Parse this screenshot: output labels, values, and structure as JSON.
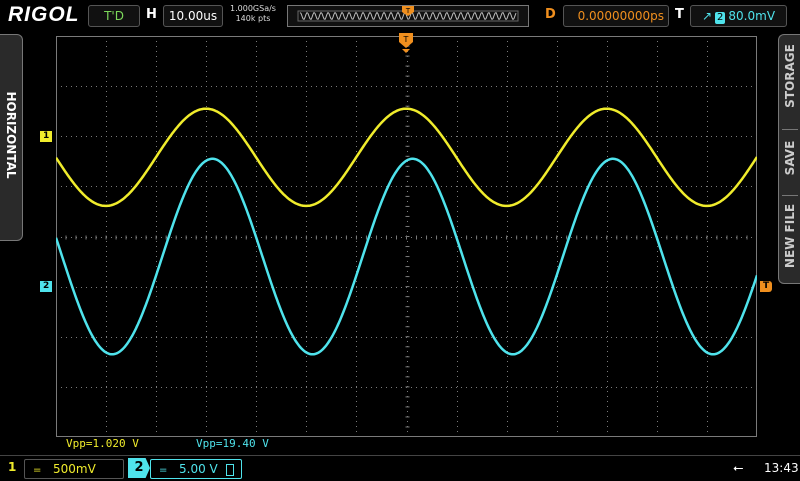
{
  "header": {
    "brand": "RIGOL",
    "trigger_status": "T'D",
    "horizontal_label": "H",
    "timebase": "10.00us",
    "sample_rate": "1.000GSa/s",
    "memory_depth": "140k pts",
    "delay_label": "D",
    "delay": "0.00000000ps",
    "trigger_label": "T",
    "trigger_source": "2",
    "trigger_level": "80.0mV",
    "trigger_position_marker": "T"
  },
  "side_menus": {
    "left": "HORIZONTAL",
    "right": [
      "STORAGE",
      "SAVE",
      "NEW FILE"
    ]
  },
  "channel_markers": {
    "ch1": "1",
    "ch2": "2",
    "trigger_level_marker": "T"
  },
  "measurements": {
    "ch1_vpp": "Vpp=1.020 V",
    "ch2_vpp": "Vpp=19.40 V"
  },
  "footer": {
    "ch1_num": "1",
    "ch1_coupling": "=",
    "ch1_scale": "500mV",
    "ch2_num": "2",
    "ch2_coupling": "=",
    "ch2_scale": "5.00 V",
    "clock": "13:43"
  },
  "colors": {
    "ch1": "#f0ec2c",
    "ch2": "#4fe3ec",
    "trigger": "#f08f1e",
    "grid": "#7a7a7a"
  },
  "waveforms": {
    "period_us": 40,
    "ch1_peak_to_peak_div": 2.0,
    "ch2_peak_to_peak_div": 3.9
  }
}
